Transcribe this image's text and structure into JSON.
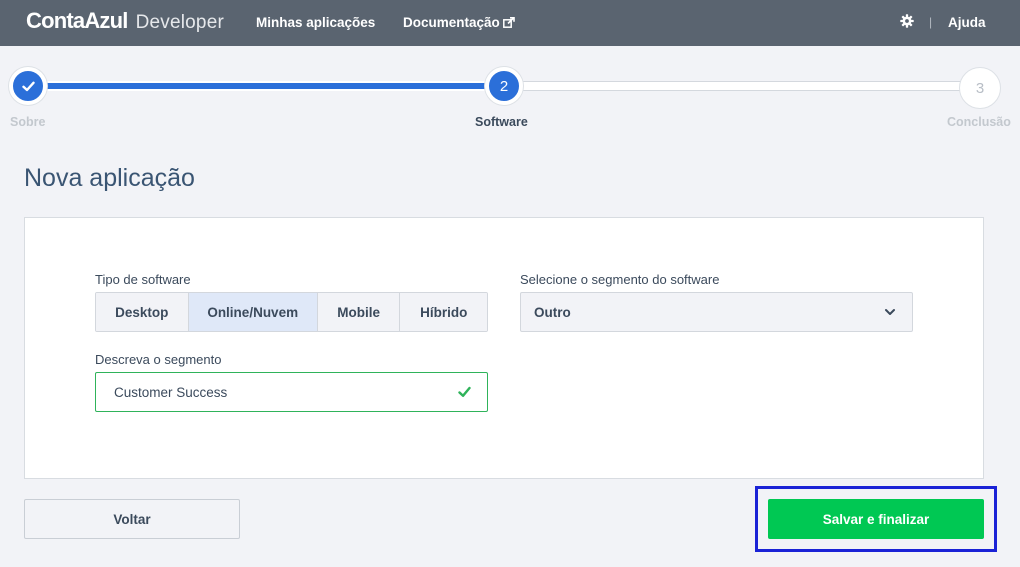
{
  "colors": {
    "header_bg": "#5a6470",
    "accent_blue": "#2b6fd9",
    "success_green": "#00c853",
    "valid_border": "#2fb35a",
    "focus_ring": "#1a22d6",
    "title_color": "#3a5573"
  },
  "header": {
    "brand_name": "ContaAzul",
    "brand_sub": "Developer",
    "nav": {
      "apps": "Minhas aplicações",
      "docs": "Documentação",
      "help": "Ajuda"
    },
    "separator": "|",
    "icons": [
      "external-link-icon",
      "gear-icon"
    ]
  },
  "stepper": {
    "current_step": 2,
    "steps": [
      {
        "number": "1",
        "label": "Sobre",
        "state": "done"
      },
      {
        "number": "2",
        "label": "Software",
        "state": "active"
      },
      {
        "number": "3",
        "label": "Conclusão",
        "state": "pending"
      }
    ]
  },
  "page": {
    "title": "Nova aplicação"
  },
  "form": {
    "software_type": {
      "label": "Tipo de software",
      "selected": "Online/Nuvem",
      "options": [
        "Desktop",
        "Online/Nuvem",
        "Mobile",
        "Híbrido"
      ]
    },
    "segment": {
      "label": "Selecione o segmento do software",
      "value": "Outro"
    },
    "segment_description": {
      "label": "Descreva o segmento",
      "value": "Customer Success",
      "valid": true
    }
  },
  "actions": {
    "back": "Voltar",
    "save": "Salvar e finalizar"
  }
}
